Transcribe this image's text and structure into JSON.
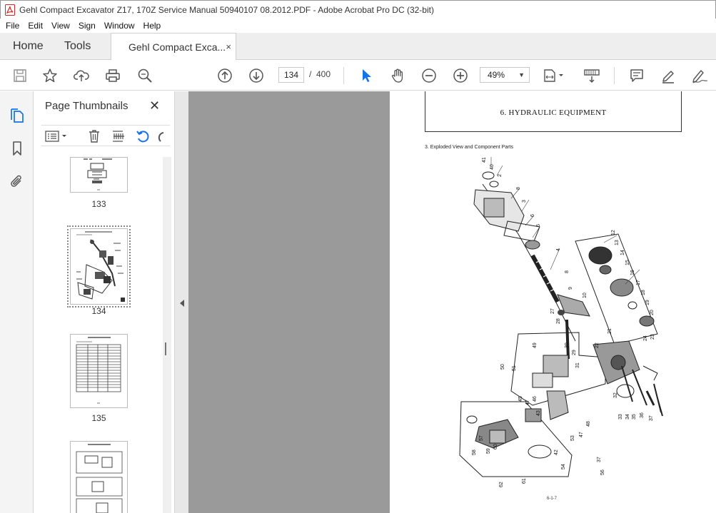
{
  "window": {
    "title": "Gehl Compact Excavator Z17, 170Z Service Manual 50940107 08.2012.PDF - Adobe Acrobat Pro DC (32-bit)"
  },
  "menu": [
    "File",
    "Edit",
    "View",
    "Sign",
    "Window",
    "Help"
  ],
  "tabs": {
    "home": "Home",
    "tools": "Tools",
    "document": "Gehl Compact Exca...",
    "close": "×"
  },
  "toolbar": {
    "current_page": "134",
    "separator": "/",
    "total_pages": "400",
    "zoom": "49%"
  },
  "thumbnail_panel": {
    "title": "Page Thumbnails",
    "close": "✕",
    "pages": [
      "133",
      "134",
      "135"
    ],
    "selected_page": "134"
  },
  "document": {
    "chapter_title": "6. HYDRAULIC EQUIPMENT",
    "section_title": "3.   Exploded View and Component Parts",
    "page_number": "6-1-7"
  },
  "colors": {
    "accent": "#1473e6",
    "viewer_bg": "#9a9a9a",
    "tab_bar": "#eeeeee",
    "app_icon": "#d7261e"
  }
}
